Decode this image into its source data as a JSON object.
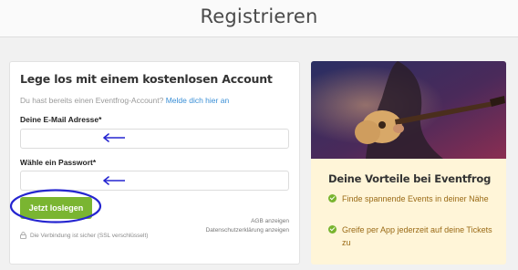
{
  "header": {
    "title": "Registrieren"
  },
  "form": {
    "heading": "Lege los mit einem kostenlosen Account",
    "login_prompt": "Du hast bereits einen Eventfrog-Account?",
    "login_link": "Melde dich hier an",
    "email_label": "Deine E-Mail Adresse*",
    "email_value": "",
    "password_label": "Wähle ein Passwort*",
    "password_value": "",
    "submit_label": "Jetzt loslegen",
    "secure_note": "Die Verbindung ist sicher (SSL verschlüsselt)",
    "agb_link": "AGB anzeigen",
    "privacy_link": "Datenschutzerklärung anzeigen"
  },
  "benefits": {
    "title": "Deine Vorteile bei Eventfrog",
    "items": [
      {
        "text": "Finde spannende Events in deiner Nähe",
        "icon": "check-circle-icon"
      },
      {
        "text": "Greife per App jederzeit auf deine Tickets zu",
        "icon": "check-circle-icon"
      }
    ]
  },
  "colors": {
    "accent_green": "#7ab531",
    "link_blue": "#3a8fd6",
    "benefit_text": "#9a6a16",
    "benefit_bg": "#fff5d8",
    "annotation": "#2525d0"
  }
}
